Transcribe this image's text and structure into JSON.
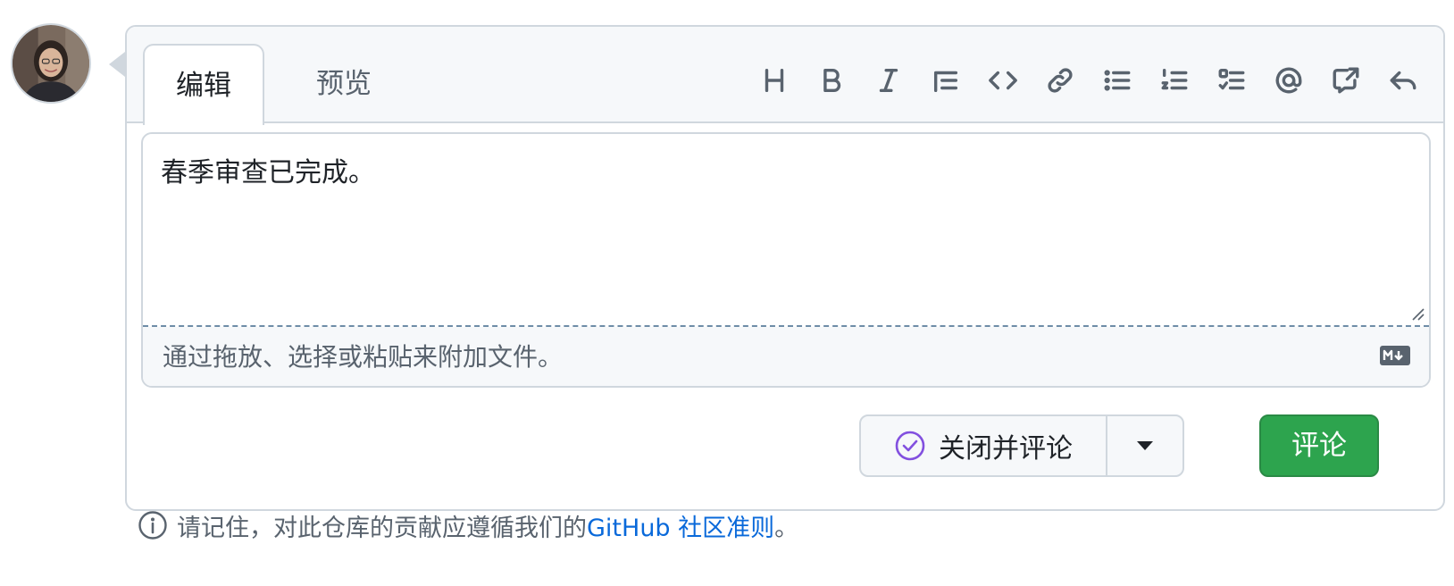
{
  "editor": {
    "tabs": [
      {
        "label": "编辑",
        "active": true
      },
      {
        "label": "预览",
        "active": false
      }
    ],
    "toolbar_icons": [
      "heading-icon",
      "bold-icon",
      "italic-icon",
      "quote-icon",
      "code-icon",
      "link-icon",
      "unordered-list-icon",
      "ordered-list-icon",
      "task-list-icon",
      "mention-icon",
      "cross-reference-icon",
      "reply-icon"
    ],
    "text": "春季审查已完成。",
    "attach_hint": "通过拖放、选择或粘贴来附加文件。"
  },
  "actions": {
    "close_and_comment_label": "关闭并评论",
    "comment_label": "评论"
  },
  "footer": {
    "prefix": "请记住，对此仓库的贡献应遵循我们的",
    "link_text": "GitHub 社区准则",
    "suffix": "。"
  },
  "colors": {
    "accent_green": "#2da44e",
    "link_blue": "#0969da",
    "close_purple": "#8250df",
    "border": "#d0d7de"
  }
}
